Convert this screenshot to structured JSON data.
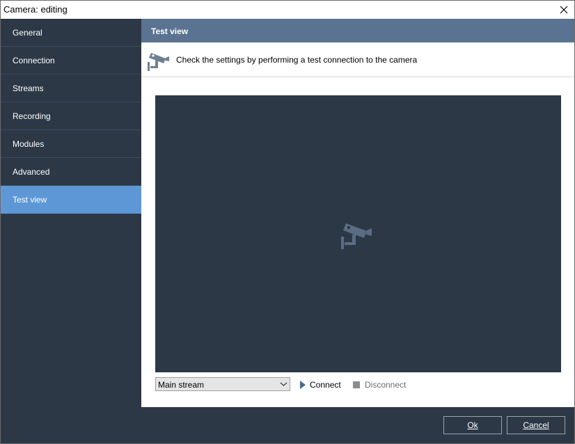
{
  "window": {
    "title": "Camera: editing"
  },
  "sidebar": {
    "items": [
      {
        "label": "General",
        "active": false
      },
      {
        "label": "Connection",
        "active": false
      },
      {
        "label": "Streams",
        "active": false
      },
      {
        "label": "Recording",
        "active": false
      },
      {
        "label": "Modules",
        "active": false
      },
      {
        "label": "Advanced",
        "active": false
      },
      {
        "label": "Test view",
        "active": true
      }
    ]
  },
  "main": {
    "section_title": "Test view",
    "info_text": "Check the settings by performing a test connection to the camera",
    "info_icon": "security-camera-icon",
    "video_placeholder_icon": "security-camera-icon",
    "controls": {
      "stream_select_value": "Main stream",
      "connect_label": "Connect",
      "disconnect_label": "Disconnect"
    }
  },
  "footer": {
    "ok_label": "Ok",
    "cancel_label": "Cancel"
  },
  "colors": {
    "sidebar_bg": "#2d3847",
    "active_item": "#5e97d6",
    "header_bg": "#5a7391",
    "video_bg": "#2d3847"
  }
}
